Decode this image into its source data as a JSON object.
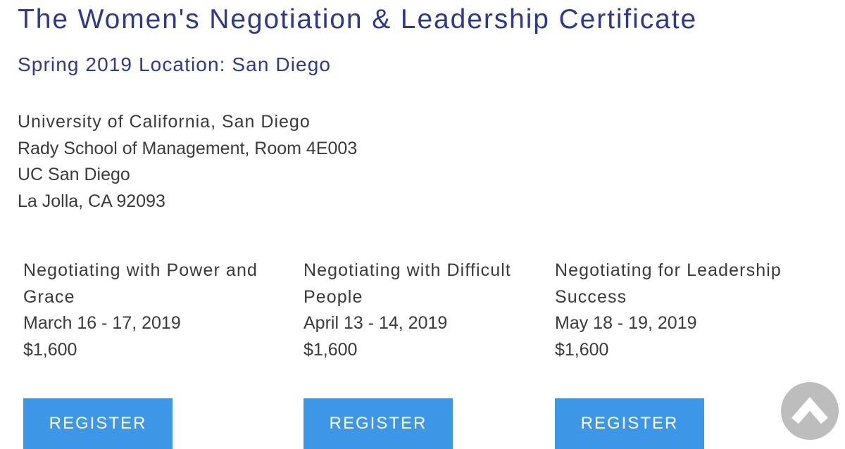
{
  "header": {
    "title": "The Women's Negotiation & Leadership Certificate",
    "subtitle": "Spring 2019 Location: San Diego"
  },
  "address": {
    "line1": "University of California, San Diego",
    "line2": "Rady School of Management, Room 4E003",
    "line3": "UC San Diego",
    "line4": "La Jolla, CA 92093"
  },
  "courses": [
    {
      "title": "Negotiating with Power and Grace",
      "dates": "March 16 - 17, 2019",
      "price": "$1,600",
      "button_label": "REGISTER"
    },
    {
      "title": "Negotiating with Difficult People",
      "dates": "April 13 - 14, 2019",
      "price": "$1,600",
      "button_label": "REGISTER"
    },
    {
      "title": "Negotiating for Leadership Success",
      "dates": "May 18 - 19, 2019",
      "price": "$1,600",
      "button_label": "REGISTER"
    }
  ],
  "scroll_top": {
    "icon": "chevron-up-icon"
  },
  "colors": {
    "heading": "#2b3990",
    "body_text": "#3a3a3a",
    "button_bg": "#3d97e6",
    "button_text": "#ffffff",
    "scroll_button_bg": "#bdbdbd"
  }
}
